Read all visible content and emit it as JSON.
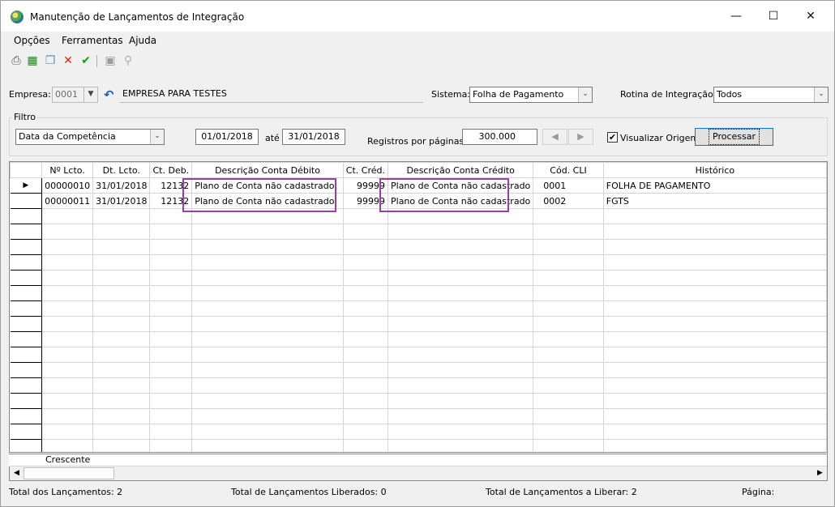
{
  "window": {
    "title": "Manutenção de Lançamentos de Integração"
  },
  "menu": {
    "items": [
      "Opções",
      "Ferramentas",
      "Ajuda"
    ]
  },
  "toolbar": {
    "icons": [
      "printer-icon",
      "export-icon",
      "copy-icon",
      "delete-icon",
      "confirm-icon",
      "binoculars-icon",
      "search-icon"
    ]
  },
  "empresa": {
    "label": "Empresa:",
    "code": "0001",
    "name": "EMPRESA PARA TESTES"
  },
  "sistema": {
    "label": "Sistema:",
    "value": "Folha de Pagamento"
  },
  "rotina": {
    "label": "Rotina de Integração:",
    "value": "Todos"
  },
  "filtro": {
    "title": "Filtro",
    "type": "Data da Competência",
    "date_from": "01/01/2018",
    "ate_label": "até",
    "date_to": "31/01/2018",
    "registros_label": "Registros por páginas:",
    "registros_value": "300.000",
    "visualizar_label": "Visualizar Origem",
    "visualizar_checked": "✔",
    "processar_label": "Processar"
  },
  "grid": {
    "columns": [
      "Nº Lcto.",
      "Dt. Lcto.",
      "Ct. Deb.",
      "Descrição Conta Débito",
      "Ct. Créd.",
      "Descrição Conta Crédito",
      "Cód. CLI",
      "Histórico"
    ],
    "rows": [
      [
        "00000010",
        "31/01/2018",
        "12132",
        "Plano de Conta não cadastrado",
        "99999",
        "Plano de Conta não cadastrado",
        "0001",
        "FOLHA DE PAGAMENTO"
      ],
      [
        "00000011",
        "31/01/2018",
        "12132",
        "Plano de Conta não cadastrado",
        "99999",
        "Plano de Conta não cadastrado",
        "0002",
        "FGTS"
      ]
    ],
    "footer": "Crescente",
    "current_row_marker": "▶"
  },
  "status": {
    "total": "Total dos Lançamentos: 2",
    "liberados": "Total de Lançamentos Liberados: 0",
    "a_liberar": "Total de Lançamentos a Liberar: 2",
    "pagina": "Página:"
  }
}
